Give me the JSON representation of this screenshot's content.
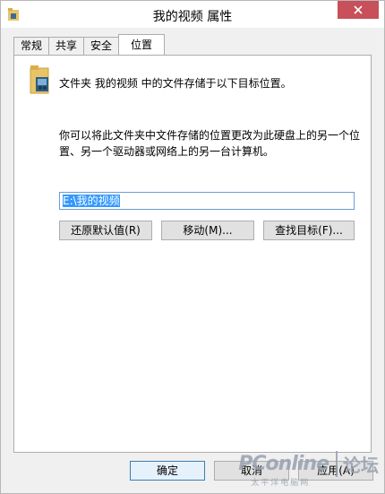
{
  "window": {
    "title": "我的视频 属性"
  },
  "tabs": [
    {
      "label": "常规",
      "active": false
    },
    {
      "label": "共享",
      "active": false
    },
    {
      "label": "安全",
      "active": false
    },
    {
      "label": "位置",
      "active": true
    }
  ],
  "location": {
    "description": "文件夹 我的视频 中的文件存储于以下目标位置。",
    "explanation": "你可以将此文件夹中文件存储的位置更改为此硬盘上的另一个位置、另一个驱动器或网络上的另一台计算机。",
    "path_value": "E:\\我的视频",
    "restore_label": "还原默认值(R)",
    "move_label": "移动(M)...",
    "find_label": "查找目标(F)..."
  },
  "footer": {
    "ok_label": "确定",
    "cancel_label": "取消",
    "apply_label": "应用(A)"
  },
  "watermark": {
    "logo": "PConline",
    "subtitle": "太平洋电脑网",
    "forum": "论坛"
  },
  "icons": {
    "title_icon": "folder-video-icon",
    "panel_icon": "folder-video-icon",
    "close_icon": "close-icon"
  },
  "colors": {
    "close_button": "#c7505a",
    "selection": "#3399ff",
    "input_border": "#6e9bd6"
  }
}
